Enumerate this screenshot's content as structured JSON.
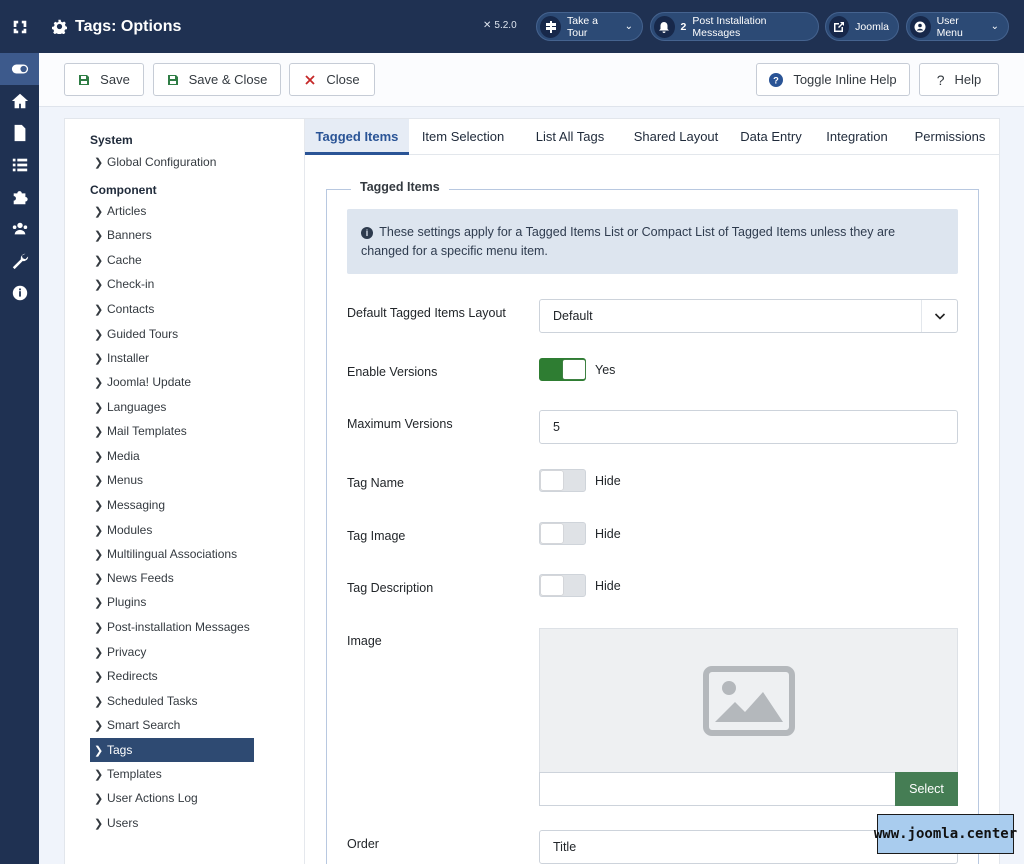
{
  "header": {
    "title": "Tags: Options",
    "version": "5.2.0",
    "take_tour": "Take a Tour",
    "notif_count": "2",
    "post_install": "Post Installation Messages",
    "site_link": "Joomla",
    "user_menu": "User Menu"
  },
  "toolbar": {
    "save": "Save",
    "save_close": "Save & Close",
    "close": "Close",
    "toggle_help": "Toggle Inline Help",
    "help": "Help"
  },
  "sidebar": {
    "system_heading": "System",
    "global_config": "Global Configuration",
    "component_heading": "Component",
    "items": [
      "Articles",
      "Banners",
      "Cache",
      "Check-in",
      "Contacts",
      "Guided Tours",
      "Installer",
      "Joomla! Update",
      "Languages",
      "Mail Templates",
      "Media",
      "Menus",
      "Messaging",
      "Modules",
      "Multilingual Associations",
      "News Feeds",
      "Plugins",
      "Post-installation Messages",
      "Privacy",
      "Redirects",
      "Scheduled Tasks",
      "Smart Search",
      "Tags",
      "Templates",
      "User Actions Log",
      "Users"
    ],
    "active_item": "Tags"
  },
  "tabs": [
    "Tagged Items",
    "Item Selection",
    "List All Tags",
    "Shared Layout",
    "Data Entry",
    "Integration",
    "Permissions"
  ],
  "form": {
    "legend": "Tagged Items",
    "alert": "These settings apply for a Tagged Items List or Compact List of Tagged Items unless they are changed for a specific menu item.",
    "layout_label": "Default Tagged Items Layout",
    "layout_value": "Default",
    "versions_label": "Enable Versions",
    "versions_value": "Yes",
    "max_versions_label": "Maximum Versions",
    "max_versions_value": "5",
    "tag_name_label": "Tag Name",
    "tag_name_value": "Hide",
    "tag_image_label": "Tag Image",
    "tag_image_value": "Hide",
    "tag_desc_label": "Tag Description",
    "tag_desc_value": "Hide",
    "image_label": "Image",
    "select_button": "Select",
    "order_label": "Order",
    "order_value": "Title"
  },
  "watermark": "www.joomla.center",
  "colors": {
    "header_bg": "#1f3152",
    "toggle_on": "#2e7d32",
    "select_button": "#457d54",
    "active_nav": "#2e4a72"
  }
}
